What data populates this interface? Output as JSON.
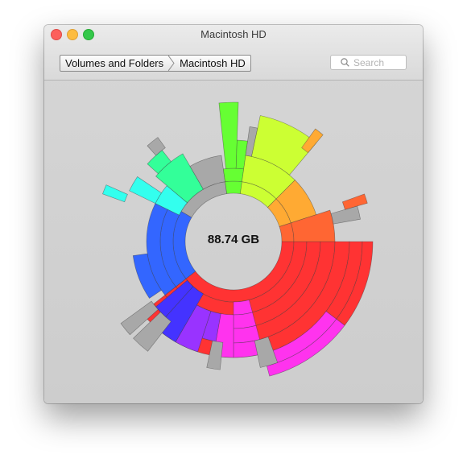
{
  "window": {
    "title": "Macintosh HD",
    "buttons": {
      "close": "close",
      "minimize": "minimize",
      "zoom": "zoom"
    }
  },
  "breadcrumb": {
    "items": [
      {
        "label": "Volumes and Folders"
      },
      {
        "label": "Macintosh HD"
      }
    ]
  },
  "search": {
    "placeholder": "Search",
    "icon": "magnifier-icon"
  },
  "sunburst": {
    "center_label": "88.74 GB",
    "background_color": "#d2d2d2",
    "hub_color": "#ffffff",
    "colors": {
      "red": "#ff3333",
      "magenta": "#ff33ee",
      "violet": "#9933ff",
      "indigo": "#4433ff",
      "blue": "#3366ff",
      "cyan": "#33ffee",
      "mint": "#33ff99",
      "green": "#66ff33",
      "yellow_green": "#ccff33",
      "orange": "#ffaa33",
      "orange_red": "#ff6633",
      "gray": "#a8a8a8"
    }
  }
}
